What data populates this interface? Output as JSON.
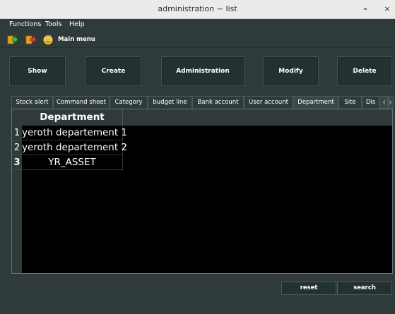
{
  "window": {
    "title": "administration ~ list",
    "minimize_glyph": "–",
    "close_glyph": "×"
  },
  "menubar": {
    "items": [
      "Functions",
      "Tools",
      "Help"
    ]
  },
  "toolbar": {
    "icons": [
      "exit-arrow-icon",
      "logout-arrow-icon",
      "smiley-face-icon"
    ],
    "main_menu_label": "Main menu"
  },
  "actions": {
    "show": "Show",
    "create": "Create",
    "administration": "Administration",
    "modify": "Modify",
    "delete": "Delete"
  },
  "tabs": {
    "items": [
      "Stock alert",
      "Command sheet",
      "Category",
      "budget line",
      "Bank account",
      "User account",
      "Department",
      "Site",
      "Dis"
    ],
    "active": "Department"
  },
  "table": {
    "columns": [
      "Department"
    ],
    "rows": [
      {
        "num": "1",
        "department": "yeroth departement 1"
      },
      {
        "num": "2",
        "department": "yeroth departement 2"
      },
      {
        "num": "3",
        "department": "YR_ASSET"
      }
    ],
    "selected_row": "3"
  },
  "footer": {
    "reset": "reset",
    "search": "search"
  },
  "colors": {
    "window_bg": "#2f3b3b",
    "table_bg": "#000000",
    "text": "#ffffff",
    "titlebar_bg": "#ebebeb"
  }
}
